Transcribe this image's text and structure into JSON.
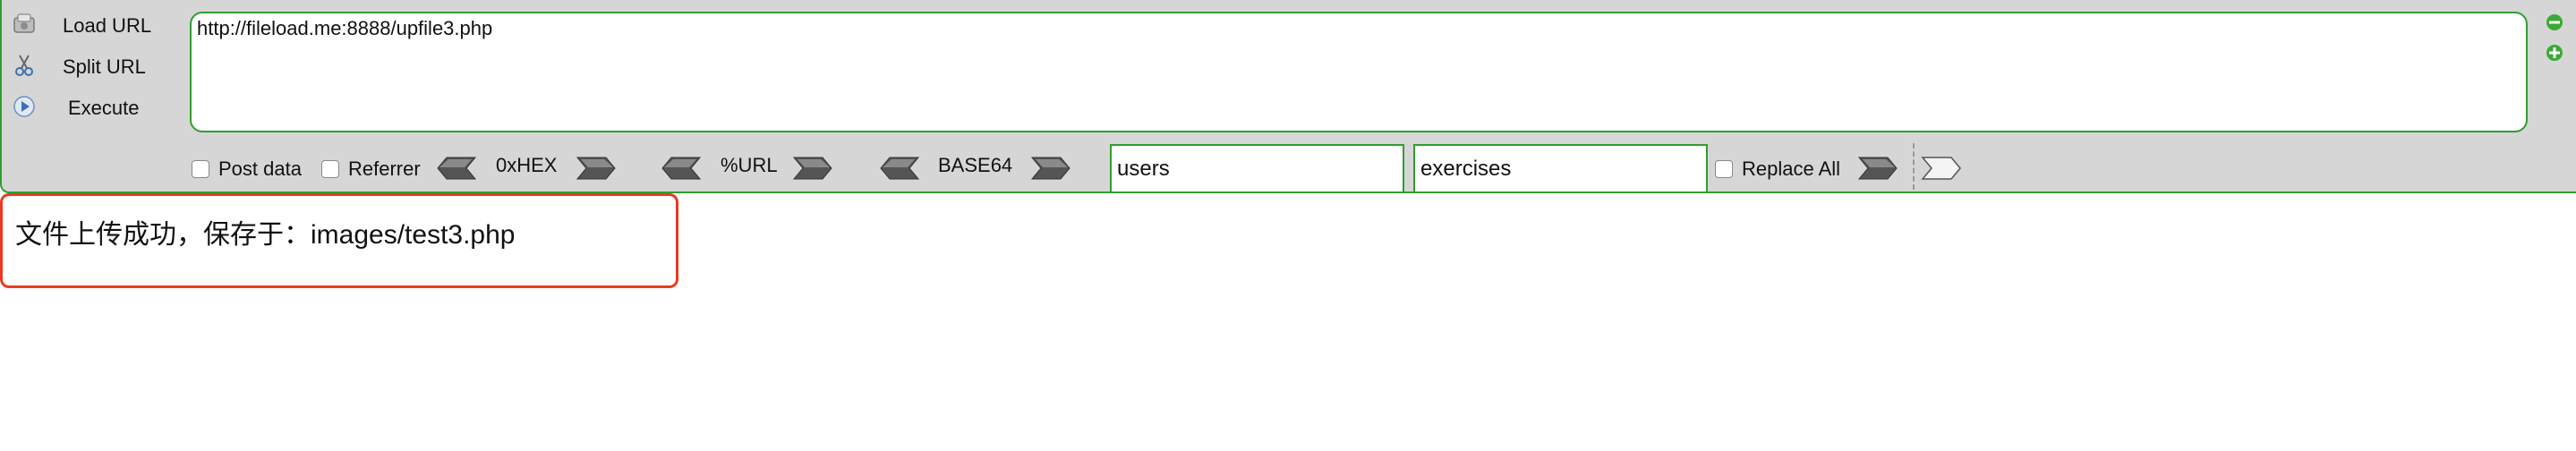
{
  "hackbar": {
    "actions": [
      {
        "label": "Load URL",
        "icon": "load-url-icon"
      },
      {
        "label": "Split URL",
        "icon": "scissors-icon"
      },
      {
        "label": "Execute",
        "icon": "play-icon"
      }
    ],
    "url_value": "http://fileload.me:8888/upfile3.php",
    "right_controls": [
      "minus-icon",
      "plus-icon"
    ],
    "options": {
      "post_data_label": "Post data",
      "referrer_label": "Referrer",
      "hex_label": "0xHEX",
      "url_label": "%URL",
      "base64_label": "BASE64",
      "find_value": "users",
      "replace_value": "exercises",
      "replace_all_label": "Replace All"
    },
    "colors": {
      "toolbar_bg": "#d6d6d6",
      "accent_green": "#2f9e2f",
      "arrow_gray": "#555555"
    }
  },
  "page": {
    "result_message": "文件上传成功，保存于：images/test3.php",
    "highlight_color": "#ea3a1f"
  }
}
